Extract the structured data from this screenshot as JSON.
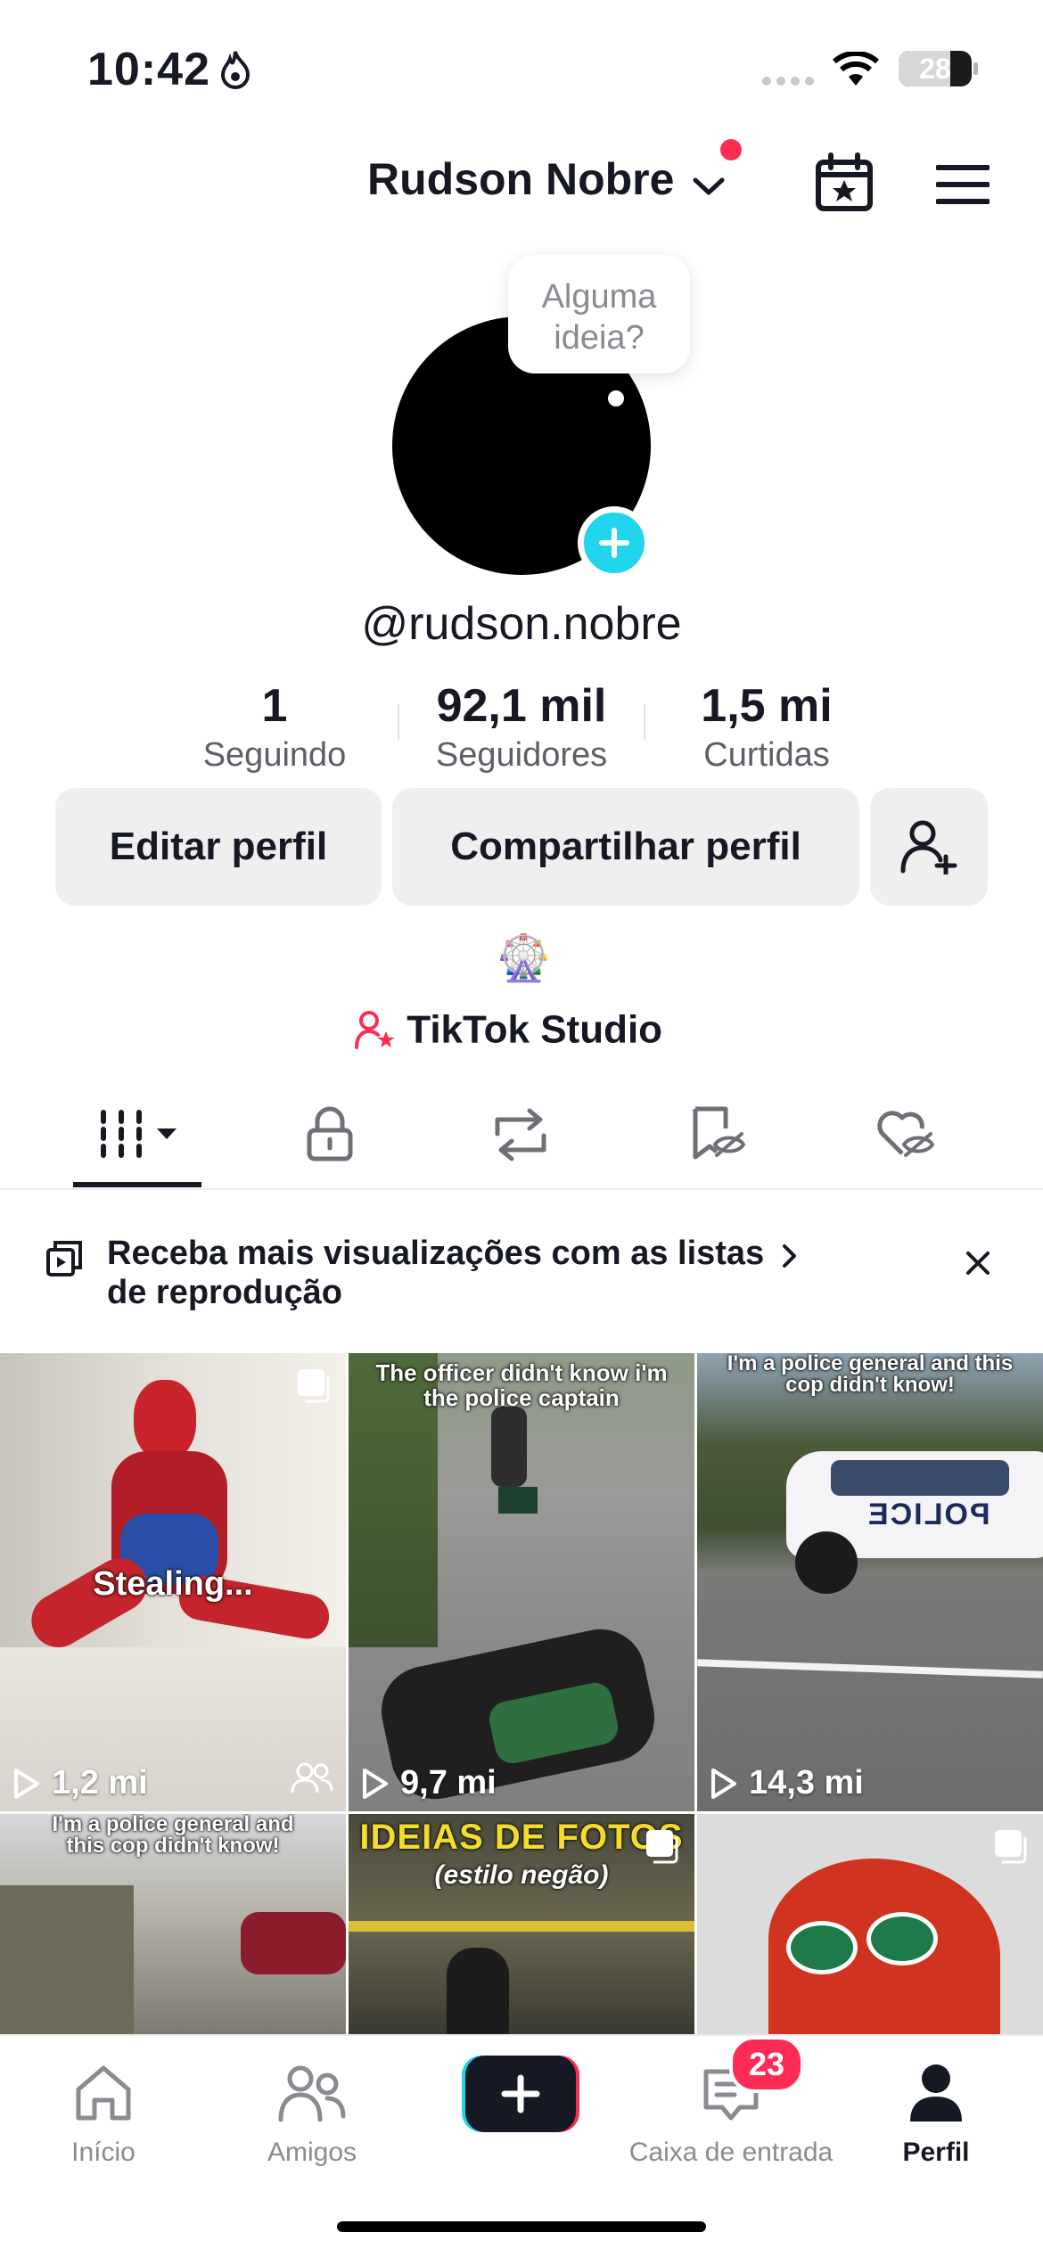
{
  "status_bar": {
    "time": "10:42",
    "battery": "28"
  },
  "header": {
    "name": "Rudson Nobre"
  },
  "avatar": {
    "bubble_text": "Alguma ideia?"
  },
  "profile": {
    "username": "@rudson.nobre"
  },
  "stats": [
    {
      "value": "1",
      "label": "Seguindo"
    },
    {
      "value": "92,1 mil",
      "label": "Seguidores"
    },
    {
      "value": "1,5 mi",
      "label": "Curtidas"
    }
  ],
  "actions": {
    "edit": "Editar perfil",
    "share": "Compartilhar perfil"
  },
  "bio_icon": "🎡",
  "studio_label": "TikTok Studio",
  "tabs": [
    "videos-grid-icon",
    "lock-icon",
    "repost-icon",
    "saved-icon",
    "liked-icon"
  ],
  "banner": {
    "text": "Receba mais visualizações com as listas de reprodução"
  },
  "videos": [
    {
      "caption": "Stealing...",
      "views": "1,2 mi"
    },
    {
      "caption": "The officer didn't know i'm the police captain",
      "views": "9,7 mi"
    },
    {
      "caption": "I'm a police general and this cop didn't know!",
      "views": "14,3 mi",
      "car_text": "POLICE"
    },
    {
      "caption": "I'm a police general and this cop didn't know!"
    },
    {
      "caption": "IDEIAS DE FOTOS",
      "subcaption": "(estilo negão)"
    },
    {
      "caption": ""
    }
  ],
  "nav": {
    "home": "Início",
    "friends": "Amigos",
    "inbox": "Caixa de entrada",
    "inbox_badge": "23",
    "profile": "Perfil"
  },
  "colors": {
    "accent": "#fe2c55",
    "cyan": "#20d5ec",
    "text": "#161823",
    "muted": "#8a8b91"
  }
}
